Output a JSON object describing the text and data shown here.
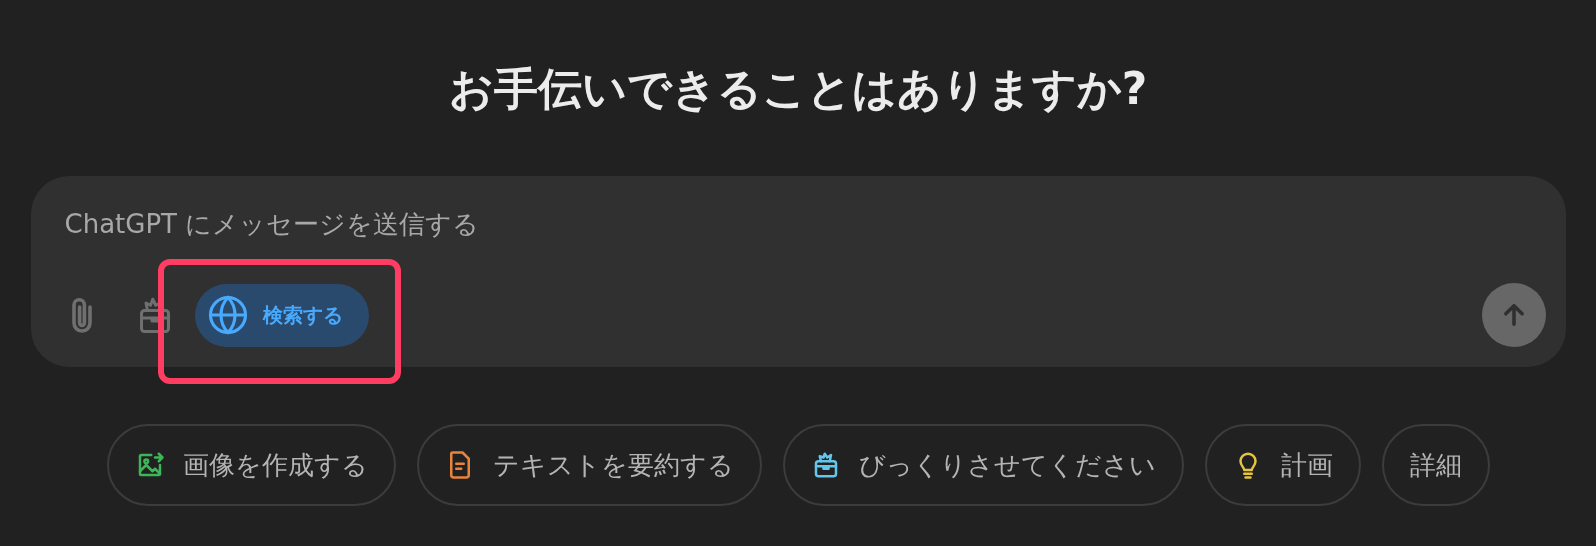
{
  "title": "お手伝いできることはありますか?",
  "composer": {
    "placeholder": "ChatGPT にメッセージを送信する",
    "search_button": {
      "label": "検索する",
      "selected": true,
      "highlighted": true
    },
    "send_button": {
      "disabled": true
    }
  },
  "suggestions": [
    {
      "kind": "image",
      "label": "画像を作成する",
      "color": "#3fb55a"
    },
    {
      "kind": "document",
      "label": "テキストを要約する",
      "color": "#e8843c"
    },
    {
      "kind": "gift",
      "label": "びっくりさせてください",
      "color": "#63c6ec"
    },
    {
      "kind": "idea",
      "label": "計画",
      "color": "#e3c53f"
    },
    {
      "kind": "more",
      "label": "詳細"
    }
  ]
}
